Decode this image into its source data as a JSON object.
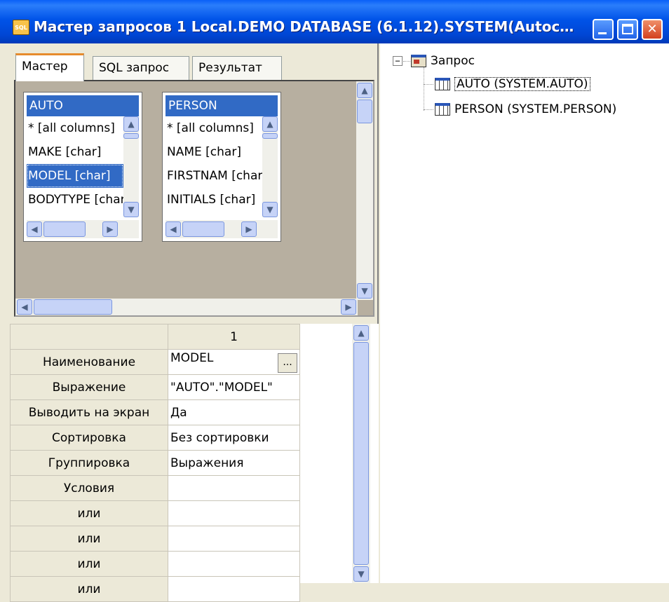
{
  "window": {
    "title": "Мастер запросов 1 Local.DEMO DATABASE (6.1.12).SYSTEM(Autoc…",
    "icon_label": "SQL"
  },
  "tabs": [
    {
      "label": "Мастер",
      "active": true
    },
    {
      "label": "SQL запрос",
      "active": false
    },
    {
      "label": "Результат",
      "active": false
    }
  ],
  "tables": [
    {
      "name": "AUTO",
      "columns": [
        "* [all columns]",
        "MAKE [char]",
        "MODEL [char]",
        "BODYTYPE [char]"
      ],
      "selected_index": 2
    },
    {
      "name": "PERSON",
      "columns": [
        "* [all columns]",
        "NAME [char]",
        "FIRSTNAM [char]",
        "INITIALS [char]"
      ],
      "selected_index": -1
    }
  ],
  "grid": {
    "column_header": "1",
    "rows": [
      {
        "label": "Наименование",
        "value": "MODEL",
        "has_button": true
      },
      {
        "label": "Выражение",
        "value": "\"AUTO\".\"MODEL\""
      },
      {
        "label": "Выводить на экран",
        "value": "Да"
      },
      {
        "label": "Сортировка",
        "value": "Без сортировки"
      },
      {
        "label": "Группировка",
        "value": "Выражения"
      },
      {
        "label": "Условия",
        "value": ""
      },
      {
        "label": "или",
        "value": ""
      },
      {
        "label": "или",
        "value": ""
      },
      {
        "label": "или",
        "value": ""
      },
      {
        "label": "или",
        "value": ""
      }
    ],
    "button_label": "..."
  },
  "tree": {
    "root": "Запрос",
    "children": [
      "AUTO (SYSTEM.AUTO)",
      "PERSON (SYSTEM.PERSON)"
    ]
  },
  "colors": {
    "titlebar": "#0053e8",
    "selection": "#316ac5",
    "panel": "#ece9d8"
  }
}
